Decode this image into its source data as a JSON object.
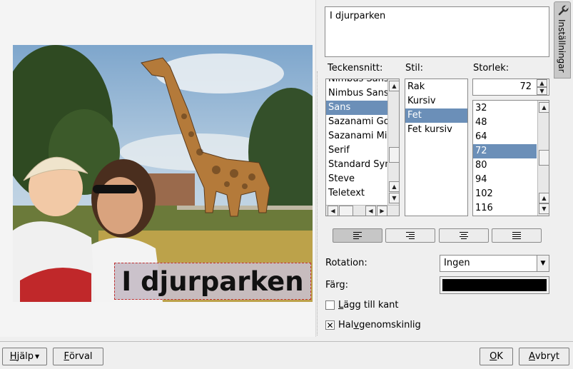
{
  "text_input": {
    "value": "I djurparken"
  },
  "settings_tab": {
    "label": "Inställningar"
  },
  "preview": {
    "caption": "I djurparken"
  },
  "font_list": {
    "header": "Teckensnitt:",
    "items": [
      "Nimbus Sans",
      "Nimbus Sans",
      "Sans",
      "Sazanami Go",
      "Sazanami Mi",
      "Serif",
      "Standard Syn",
      "Steve",
      "Teletext"
    ],
    "selected_index": 2
  },
  "style_list": {
    "header": "Stil:",
    "items": [
      "Rak",
      "Kursiv",
      "Fet",
      "Fet kursiv"
    ],
    "selected_index": 2
  },
  "size": {
    "header": "Storlek:",
    "value": "72",
    "items": [
      "32",
      "48",
      "64",
      "72",
      "80",
      "94",
      "102",
      "116"
    ],
    "selected_index": 3
  },
  "alignment": [
    "align-left",
    "align-right",
    "align-center",
    "align-justify"
  ],
  "rotation": {
    "label": "Rotation:",
    "value": "Ingen"
  },
  "color": {
    "label": "Färg:",
    "value": "#000000"
  },
  "add_border": {
    "label_pre": "",
    "label_ul": "L",
    "label_post": "ägg till kant",
    "checked": false
  },
  "semi_transparent": {
    "label_pre": "Hal",
    "label_ul": "v",
    "label_post": "genomskinlig",
    "checked": true
  },
  "buttons": {
    "help": {
      "pre": "",
      "ul": "H",
      "post": "jälp"
    },
    "defaults": {
      "pre": "",
      "ul": "F",
      "post": "örval"
    },
    "ok": {
      "pre": "",
      "ul": "O",
      "post": "K"
    },
    "cancel": {
      "pre": "",
      "ul": "A",
      "post": "vbryt"
    }
  }
}
